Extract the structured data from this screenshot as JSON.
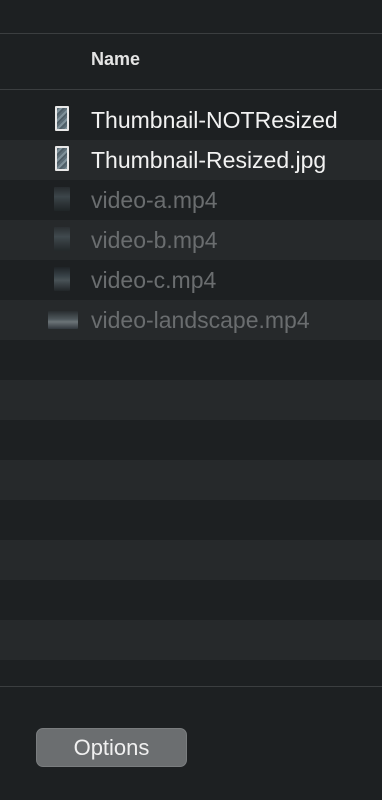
{
  "header": {
    "name_column": "Name"
  },
  "files": [
    {
      "name": "Thumbnail-NOTResized",
      "enabled": true,
      "icon": "image-thumbnail-icon"
    },
    {
      "name": "Thumbnail-Resized.jpg",
      "enabled": true,
      "icon": "image-thumbnail-icon"
    },
    {
      "name": "video-a.mp4",
      "enabled": false,
      "icon": "video-thumbnail-icon"
    },
    {
      "name": "video-b.mp4",
      "enabled": false,
      "icon": "video-thumbnail-icon"
    },
    {
      "name": "video-c.mp4",
      "enabled": false,
      "icon": "video-thumbnail-icon"
    },
    {
      "name": "video-landscape.mp4",
      "enabled": false,
      "icon": "landscape-video-thumbnail-icon"
    }
  ],
  "footer": {
    "options_label": "Options"
  }
}
